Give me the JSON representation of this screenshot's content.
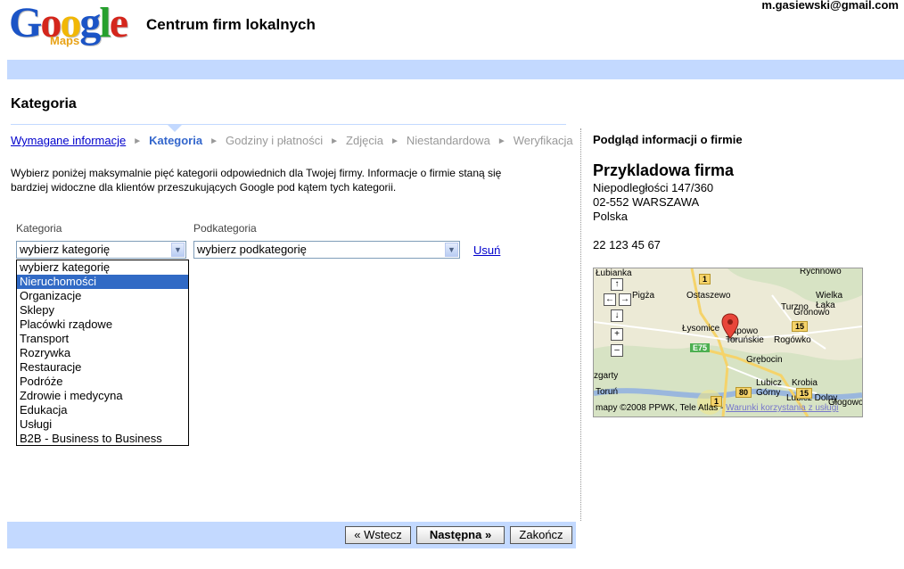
{
  "header": {
    "logo_letters": [
      "G",
      "o",
      "o",
      "g",
      "l",
      "e"
    ],
    "logo_colors": [
      "#1b54c6",
      "#d4261c",
      "#f1b706",
      "#1b54c6",
      "#26a02e",
      "#d4261c"
    ],
    "logo_sub": "Maps",
    "app_title": "Centrum firm lokalnych",
    "user_email": "m.gasiewski@gmail.com"
  },
  "page_title": "Kategoria",
  "steps": {
    "done": "Wymagane informacje",
    "current": "Kategoria",
    "next1": "Godziny i płatności",
    "next2": "Zdjęcia",
    "next3": "Niestandardowa",
    "next4": "Weryfikacja",
    "separator": "►"
  },
  "intro_text": "Wybierz poniżej maksymalnie pięć kategorii odpowiednich dla Twojej firmy. Informacje o firmie staną się bardziej widoczne dla klientów przeszukujących Google pod kątem tych kategorii.",
  "form": {
    "category_label": "Kategoria",
    "subcategory_label": "Podkategoria",
    "category_value": "wybierz kategorię",
    "subcategory_value": "wybierz podkategorię",
    "remove_link": "Usuń"
  },
  "dropdown_options": [
    "wybierz kategorię",
    "Nieruchomości",
    "Organizacje",
    "Sklepy",
    "Placówki rządowe",
    "Transport",
    "Rozrywka",
    "Restauracje",
    "Podróże",
    "Zdrowie i medycyna",
    "Edukacja",
    "Usługi",
    "B2B - Business to Business"
  ],
  "dropdown_highlighted_index": 1,
  "preview": {
    "heading": "Podgląd informacji o firmie",
    "business_name": "Przykladowa firma",
    "address1": "Niepodległości 147/360",
    "address2": "02-552 WARSZAWA",
    "country": "Polska",
    "phone": "22 123 45 67"
  },
  "map": {
    "places": {
      "lubianka": "Łubianka",
      "rychnowo": "Rychnowo",
      "ostaszewo": "Ostaszewo",
      "wielka_laka": "Wielka Łąka",
      "turzno": "Turzno",
      "gronowo": "Gronowo",
      "lysomice": "Łysomice",
      "papowo": "Papowo Toruńskie",
      "rogowko": "Rogówko",
      "grebocin": "Grębocin",
      "lubicz": "Lubicz",
      "gorny": "Górny",
      "krobia": "Krobia",
      "torun": "Toruń",
      "lubicz2": "Lubicz Dolny",
      "glogowo": "Głogowo",
      "zgarty": "zgarty",
      "pigza": "Pigża"
    },
    "road_labels": [
      "1",
      "15",
      "E75",
      "80",
      "15",
      "1"
    ],
    "attribution": "mapy ©2008 PPWK, Tele Atlas -",
    "terms_link": "Warunki korzystania z usługi",
    "pan_up": "↑",
    "pan_left": "←",
    "pan_right": "→",
    "pan_down": "↓",
    "zoom_in": "+",
    "zoom_out": "–"
  },
  "buttons": {
    "back": "« Wstecz",
    "next": "Następna »",
    "finish": "Zakończ"
  },
  "colors": {
    "accent_bar": "#c3d9ff",
    "link": "#0000cc",
    "highlight": "#316ac5"
  }
}
